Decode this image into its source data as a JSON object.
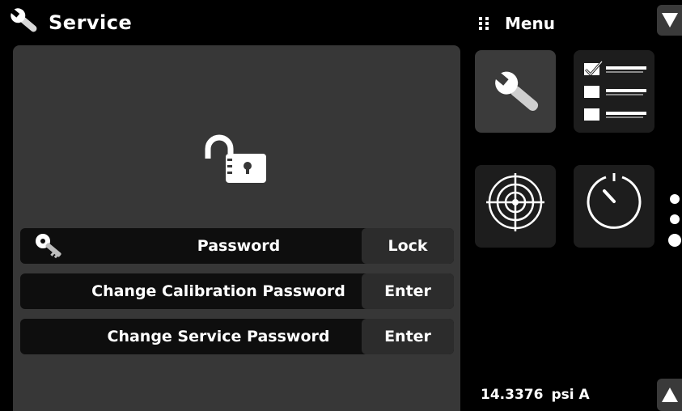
{
  "header": {
    "title": "Service"
  },
  "menu": {
    "title": "Menu"
  },
  "service": {
    "rows": [
      {
        "label": "Password",
        "action": "Lock"
      },
      {
        "label": "Change Calibration Password",
        "action": "Enter"
      },
      {
        "label": "Change Service Password",
        "action": "Enter"
      }
    ]
  },
  "tiles": [
    {
      "icon": "wrench-icon",
      "active": true
    },
    {
      "icon": "checklist-icon",
      "active": false
    },
    {
      "icon": "target-icon",
      "active": false
    },
    {
      "icon": "dial-icon",
      "active": false
    }
  ],
  "status": {
    "pressure": "14.3376",
    "unit": "psi A"
  },
  "pager": {
    "pages": 3,
    "current": 3
  },
  "colors": {
    "background": "#000000",
    "panel": "#373737",
    "row": "#0e0e0e",
    "action_button": "#2c2c2c",
    "tile_active": "#3b3b3b",
    "tile": "#1d1d1d"
  }
}
